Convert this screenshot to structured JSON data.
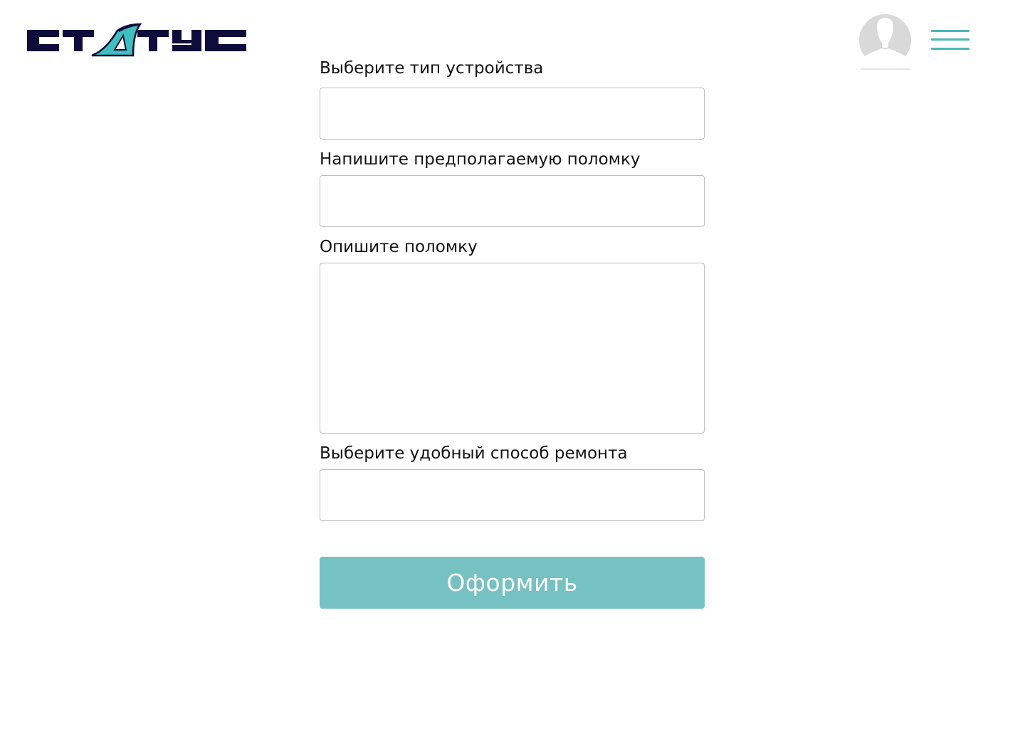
{
  "header": {
    "logo_text": "СТАТУС",
    "avatar_icon": "user-avatar-icon",
    "menu_icon": "hamburger-menu-icon"
  },
  "colors": {
    "brand_dark": "#0d0c3a",
    "brand_teal": "#3fbfbf",
    "menu_teal": "#4ab8b8",
    "button_bg": "#76c1c1",
    "field_border": "#bdbdbd"
  },
  "form": {
    "device_type_label": "Выберите тип устройства",
    "device_type_value": "",
    "suspected_fault_label": "Напишите предполагаемую поломку",
    "suspected_fault_value": "",
    "fault_description_label": "Опишите поломку",
    "fault_description_value": "",
    "repair_method_label": "Выберите удобный способ ремонта",
    "repair_method_value": "",
    "submit_label": "Оформить"
  }
}
